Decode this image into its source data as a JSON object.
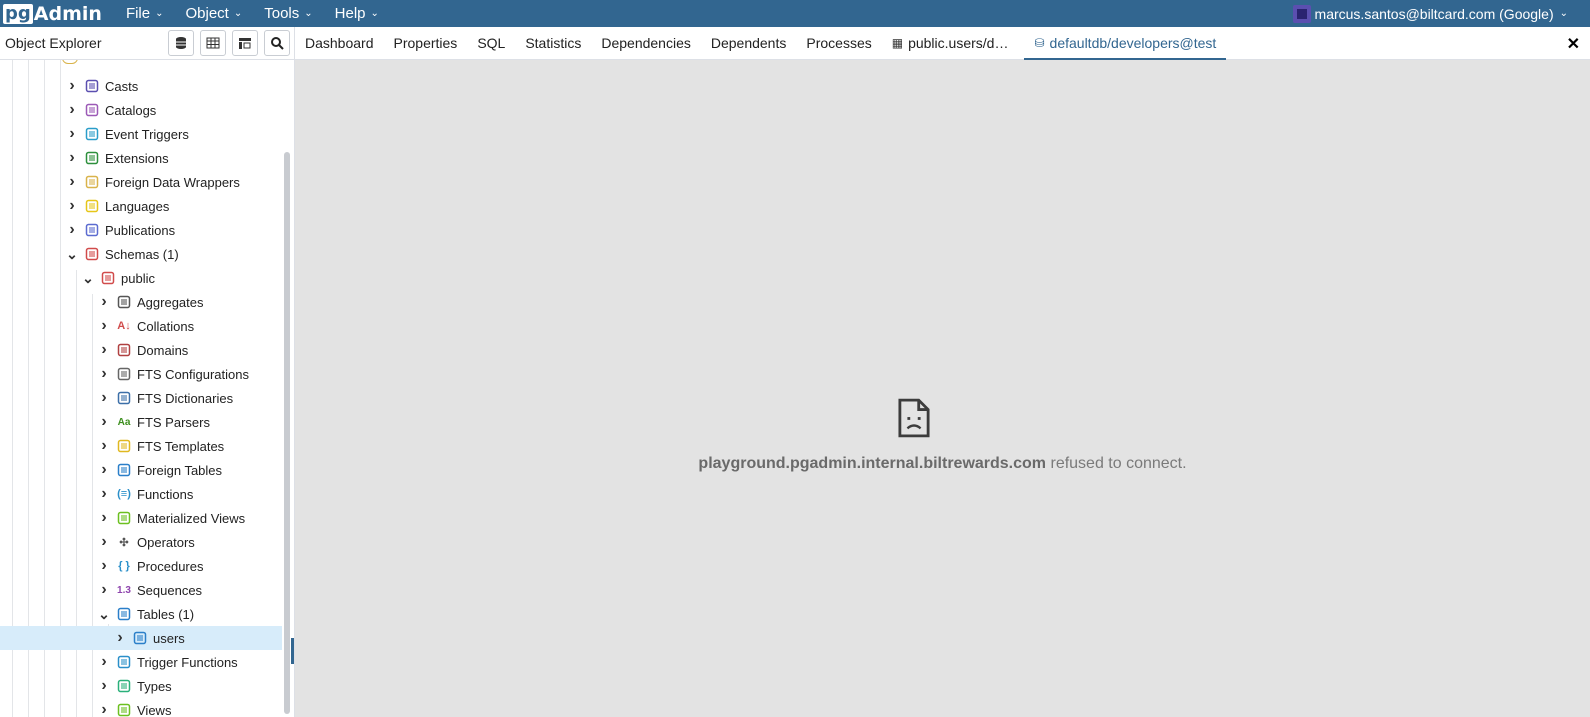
{
  "app": {
    "logo_pg": "pg",
    "logo_admin": "Admin",
    "menu": [
      "File",
      "Object",
      "Tools",
      "Help"
    ],
    "user": "marcus.santos@biltcard.com (Google)",
    "accent": "#326690"
  },
  "left_panel": {
    "title": "Object Explorer",
    "toolbar_icons": [
      "database-icon",
      "table-grid-icon",
      "query-tool-icon",
      "search-icon"
    ],
    "tree": [
      {
        "label": "Casts",
        "icon": "casts-icon",
        "depth": 1,
        "expanded": false
      },
      {
        "label": "Catalogs",
        "icon": "catalogs-icon",
        "depth": 1,
        "expanded": false
      },
      {
        "label": "Event Triggers",
        "icon": "event-triggers-icon",
        "depth": 1,
        "expanded": false
      },
      {
        "label": "Extensions",
        "icon": "extensions-icon",
        "depth": 1,
        "expanded": false
      },
      {
        "label": "Foreign Data Wrappers",
        "icon": "foreign-data-wrappers-icon",
        "depth": 1,
        "expanded": false
      },
      {
        "label": "Languages",
        "icon": "languages-icon",
        "depth": 1,
        "expanded": false
      },
      {
        "label": "Publications",
        "icon": "publications-icon",
        "depth": 1,
        "expanded": false
      },
      {
        "label": "Schemas (1)",
        "icon": "schemas-icon",
        "depth": 1,
        "expanded": true
      },
      {
        "label": "public",
        "icon": "schema-icon",
        "depth": 2,
        "expanded": true
      },
      {
        "label": "Aggregates",
        "icon": "aggregates-icon",
        "depth": 3,
        "expanded": false
      },
      {
        "label": "Collations",
        "icon": "collations-icon",
        "depth": 3,
        "expanded": false
      },
      {
        "label": "Domains",
        "icon": "domains-icon",
        "depth": 3,
        "expanded": false
      },
      {
        "label": "FTS Configurations",
        "icon": "fts-configurations-icon",
        "depth": 3,
        "expanded": false
      },
      {
        "label": "FTS Dictionaries",
        "icon": "fts-dictionaries-icon",
        "depth": 3,
        "expanded": false
      },
      {
        "label": "FTS Parsers",
        "icon": "fts-parsers-icon",
        "depth": 3,
        "expanded": false
      },
      {
        "label": "FTS Templates",
        "icon": "fts-templates-icon",
        "depth": 3,
        "expanded": false
      },
      {
        "label": "Foreign Tables",
        "icon": "foreign-tables-icon",
        "depth": 3,
        "expanded": false
      },
      {
        "label": "Functions",
        "icon": "functions-icon",
        "depth": 3,
        "expanded": false
      },
      {
        "label": "Materialized Views",
        "icon": "materialized-views-icon",
        "depth": 3,
        "expanded": false
      },
      {
        "label": "Operators",
        "icon": "operators-icon",
        "depth": 3,
        "expanded": false
      },
      {
        "label": "Procedures",
        "icon": "procedures-icon",
        "depth": 3,
        "expanded": false
      },
      {
        "label": "Sequences",
        "icon": "sequences-icon",
        "depth": 3,
        "expanded": false
      },
      {
        "label": "Tables (1)",
        "icon": "tables-icon",
        "depth": 3,
        "expanded": true
      },
      {
        "label": "users",
        "icon": "table-icon",
        "depth": 4,
        "expanded": false,
        "selected": true
      },
      {
        "label": "Trigger Functions",
        "icon": "trigger-functions-icon",
        "depth": 3,
        "expanded": false
      },
      {
        "label": "Types",
        "icon": "types-icon",
        "depth": 3,
        "expanded": false
      },
      {
        "label": "Views",
        "icon": "views-icon",
        "depth": 3,
        "expanded": false
      }
    ]
  },
  "tabs": [
    {
      "label": "Dashboard",
      "active": false
    },
    {
      "label": "Properties",
      "active": false
    },
    {
      "label": "SQL",
      "active": false
    },
    {
      "label": "Statistics",
      "active": false
    },
    {
      "label": "Dependencies",
      "active": false
    },
    {
      "label": "Dependents",
      "active": false
    },
    {
      "label": "Processes",
      "active": false
    },
    {
      "label": "public.users/d…",
      "active": false,
      "icon": "table-icon"
    },
    {
      "label": "defaultdb/developers@test",
      "active": true,
      "icon": "database-icon"
    }
  ],
  "content": {
    "error_host": "playground.pgadmin.internal.biltrewards.com",
    "error_message": "refused to connect."
  }
}
